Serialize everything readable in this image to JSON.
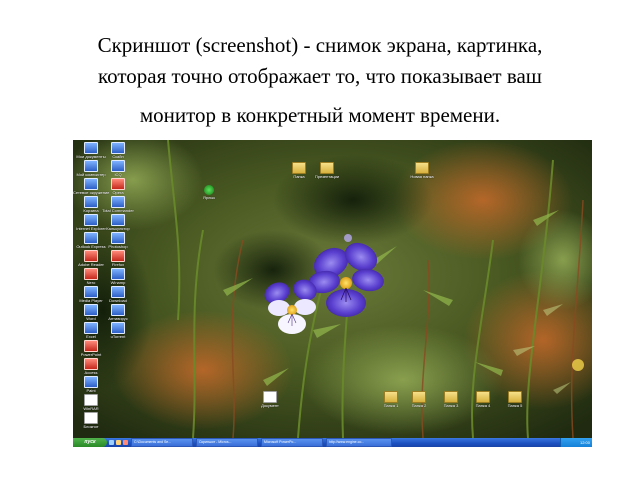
{
  "slide": {
    "title_lines": [
      "Скриншот (screenshot) - снимок экрана, картинка,",
      "которая точно отображает то, что показывает ваш",
      "монитор в конкретный момент времени."
    ]
  },
  "desktop": {
    "left_icons": [
      {
        "label": "Мои документы",
        "glyph": "app"
      },
      {
        "label": "Мой компьютер",
        "glyph": "app"
      },
      {
        "label": "Сетевое окружение",
        "glyph": "app"
      },
      {
        "label": "Корзина",
        "glyph": "app"
      },
      {
        "label": "Internet Explorer",
        "glyph": "app"
      },
      {
        "label": "Outlook Express",
        "glyph": "app"
      },
      {
        "label": "Adobe Reader",
        "glyph": "red"
      },
      {
        "label": "Nero",
        "glyph": "red"
      },
      {
        "label": "Media Player",
        "glyph": "app"
      },
      {
        "label": "Word",
        "glyph": "app"
      },
      {
        "label": "Excel",
        "glyph": "app"
      },
      {
        "label": "PowerPoint",
        "glyph": "red"
      },
      {
        "label": "Access",
        "glyph": "red"
      },
      {
        "label": "Paint",
        "glyph": "app"
      },
      {
        "label": "WinRAR",
        "glyph": "doc"
      },
      {
        "label": "Блокнот",
        "glyph": "doc"
      }
    ],
    "second_column_icons": [
      {
        "label": "Скайп",
        "glyph": "app"
      },
      {
        "label": "ICQ",
        "glyph": "app"
      },
      {
        "label": "Opera",
        "glyph": "red"
      },
      {
        "label": "Total Commander",
        "glyph": "app"
      },
      {
        "label": "Калькулятор",
        "glyph": "app"
      },
      {
        "label": "Photoshop",
        "glyph": "app"
      },
      {
        "label": "Firefox",
        "glyph": "red"
      },
      {
        "label": "Winamp",
        "glyph": "app"
      },
      {
        "label": "Download",
        "glyph": "app"
      },
      {
        "label": "Антивирус",
        "glyph": "app"
      },
      {
        "label": "uTorrent",
        "glyph": "app"
      }
    ],
    "green_icon": {
      "label": "Ярлык",
      "glyph": "green"
    },
    "top_folders": [
      {
        "label": "Папка",
        "glyph": "folder"
      },
      {
        "label": "Презентации",
        "glyph": "folder"
      },
      {
        "label": "Новая папка",
        "glyph": "folder"
      }
    ],
    "mid_doc": {
      "label": "Документ",
      "glyph": "doc"
    },
    "bottom_folders": [
      {
        "label": "Папка 1",
        "glyph": "folder"
      },
      {
        "label": "Папка 2",
        "glyph": "folder"
      },
      {
        "label": "Папка 3",
        "glyph": "folder"
      },
      {
        "label": "Папка 4",
        "glyph": "folder"
      },
      {
        "label": "Папка 5",
        "glyph": "folder"
      }
    ]
  },
  "taskbar": {
    "start_label": "пуск",
    "tasks": [
      "C:\\Documents and Se...",
      "Скриншот - Micros...",
      "Microsoft PowerPo...",
      "http://www.engine.co..."
    ],
    "clock": "12:00"
  },
  "colors": {
    "taskbar": "#1c4fc0",
    "start": "#2a8a26",
    "folder": "#d7b23e"
  }
}
